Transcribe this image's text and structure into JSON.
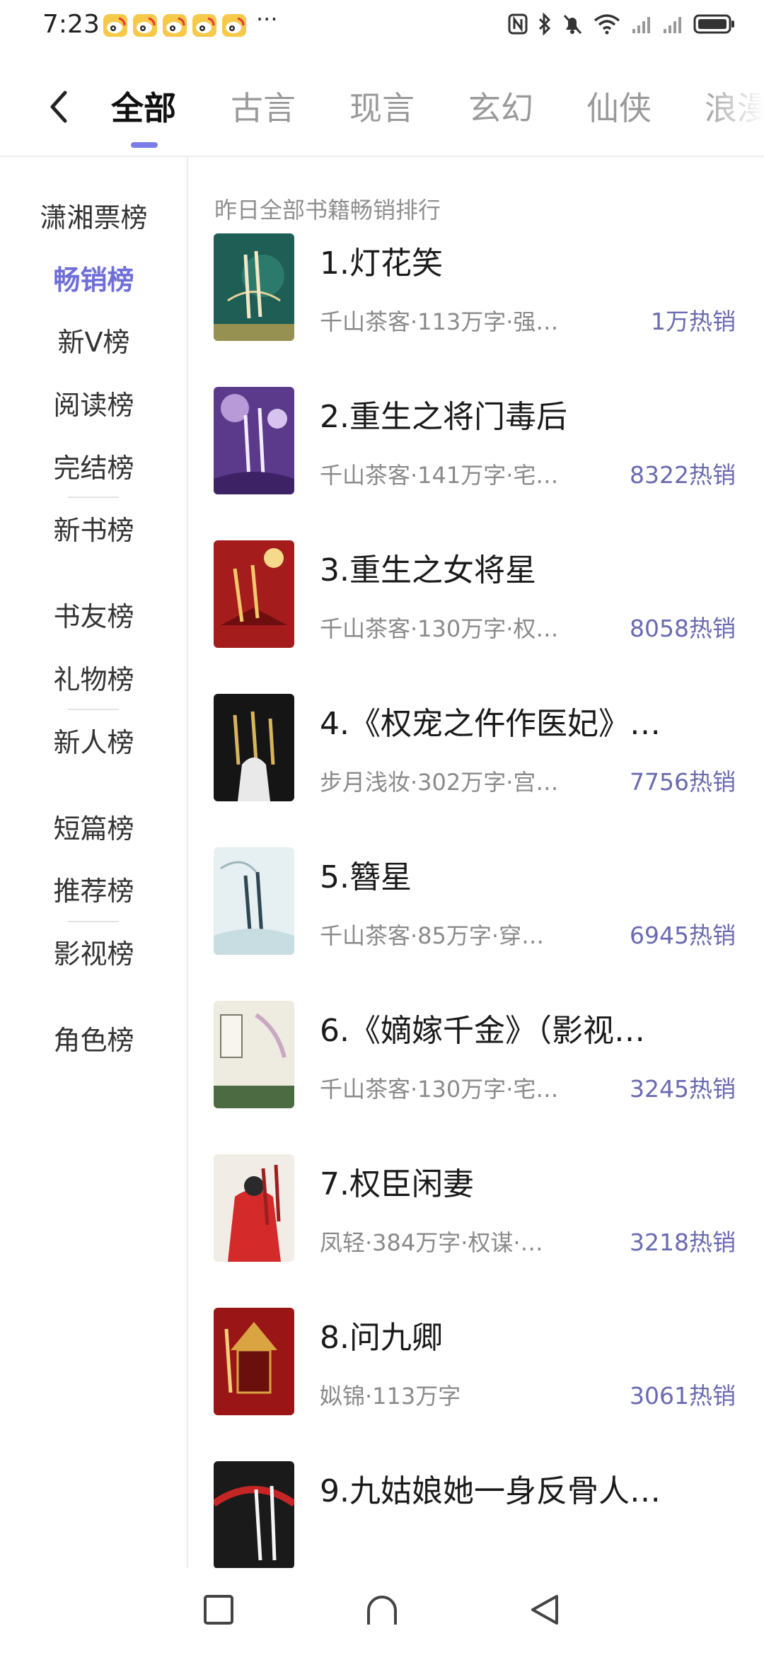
{
  "status_bar": {
    "time": "7:23",
    "dots": "···",
    "notification_icons": [
      "weibo-icon",
      "weibo-icon",
      "weibo-icon",
      "weibo-icon",
      "weibo-icon"
    ],
    "right_icons": [
      "nfc-icon",
      "bluetooth-icon",
      "mute-icon",
      "wifi-icon",
      "signal-icon",
      "signal-icon",
      "battery-icon"
    ]
  },
  "tabs": {
    "back_icon": "chevron-left-icon",
    "items": [
      "全部",
      "古言",
      "现言",
      "玄幻",
      "仙侠",
      "浪漫"
    ],
    "active_index": 0,
    "accent": "#7b7ee8"
  },
  "sidebar": {
    "items": [
      "潇湘票榜",
      "畅销榜",
      "新V榜",
      "阅读榜",
      "完结榜",
      "新书榜",
      "书友榜",
      "礼物榜",
      "新人榜",
      "短篇榜",
      "推荐榜",
      "影视榜",
      "角色榜"
    ],
    "active_index": 1,
    "active_color": "#6f6fd8"
  },
  "list": {
    "header": "昨日全部书籍畅销排行",
    "books": [
      {
        "title": "1.灯花笑",
        "meta": "千山茶客·113万字·强…",
        "sales": "1万热销"
      },
      {
        "title": "2.重生之将门毒后",
        "meta": "千山茶客·141万字·宅…",
        "sales": "8322热销"
      },
      {
        "title": "3.重生之女将星",
        "meta": "千山茶客·130万字·权…",
        "sales": "8058热销"
      },
      {
        "title": "4.《权宠之仵作医妃》…",
        "meta": "步月浅妆·302万字·宫…",
        "sales": "7756热销"
      },
      {
        "title": "5.簪星",
        "meta": "千山茶客·85万字·穿…",
        "sales": "6945热销"
      },
      {
        "title": "6.《嫡嫁千金》（影视…",
        "meta": "千山茶客·130万字·宅…",
        "sales": "3245热销"
      },
      {
        "title": "7.权臣闲妻",
        "meta": "凤轻·384万字·权谋·…",
        "sales": "3218热销"
      },
      {
        "title": "8.问九卿",
        "meta": "姒锦·113万字",
        "sales": "3061热销"
      },
      {
        "title": "9.九姑娘她一身反骨人…",
        "meta": "",
        "sales": ""
      }
    ]
  },
  "nav_bar": {
    "icons": [
      "recents-square-icon",
      "home-circle-icon",
      "back-triangle-icon"
    ]
  }
}
